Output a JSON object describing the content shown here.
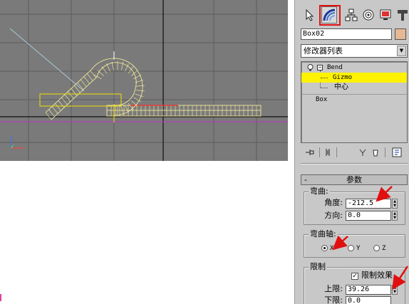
{
  "viewport": {
    "colors": {
      "background": "#7a7a7a",
      "grid": "#5a5a5a",
      "axis": "#000000",
      "object": "#fff6a0",
      "gizmo": "#f0e000",
      "selected_edge": "#ff3030",
      "magenta_line": "#c030c0",
      "diag_line": "#a8c8d8"
    }
  },
  "panel": {
    "tabs": [
      {
        "icon": "create-arrow-icon"
      },
      {
        "icon": "modify-arc-icon",
        "active": true
      },
      {
        "icon": "hierarchy-icon"
      },
      {
        "icon": "motion-icon"
      },
      {
        "icon": "display-monitor-icon"
      },
      {
        "icon": "utilities-hammer-icon"
      }
    ],
    "object_name": "Box02",
    "object_color": "#e6b894",
    "modifier_list": "修改器列表",
    "stack": {
      "items": [
        {
          "label": "Bend"
        },
        {
          "label": "Gizmo",
          "selected": true
        },
        {
          "label": "中心"
        },
        {
          "label": "Box"
        }
      ]
    },
    "rollout": {
      "title": "参数",
      "bend_group": {
        "title": "弯曲:",
        "angle_label": "角度:",
        "angle_value": "-212.5",
        "direction_label": "方向:",
        "direction_value": "0.0"
      },
      "axis_group": {
        "title": "弯曲轴:",
        "options": [
          "X",
          "Y",
          "Z"
        ],
        "selected": "X"
      },
      "limit_group": {
        "title": "限制",
        "limit_effect_label": "限制效果",
        "limit_effect_checked": true,
        "upper_label": "上限:",
        "upper_value": "39.26",
        "lower_label": "下限:",
        "lower_value": "0.0"
      }
    },
    "highlight_color": "#e01010"
  }
}
